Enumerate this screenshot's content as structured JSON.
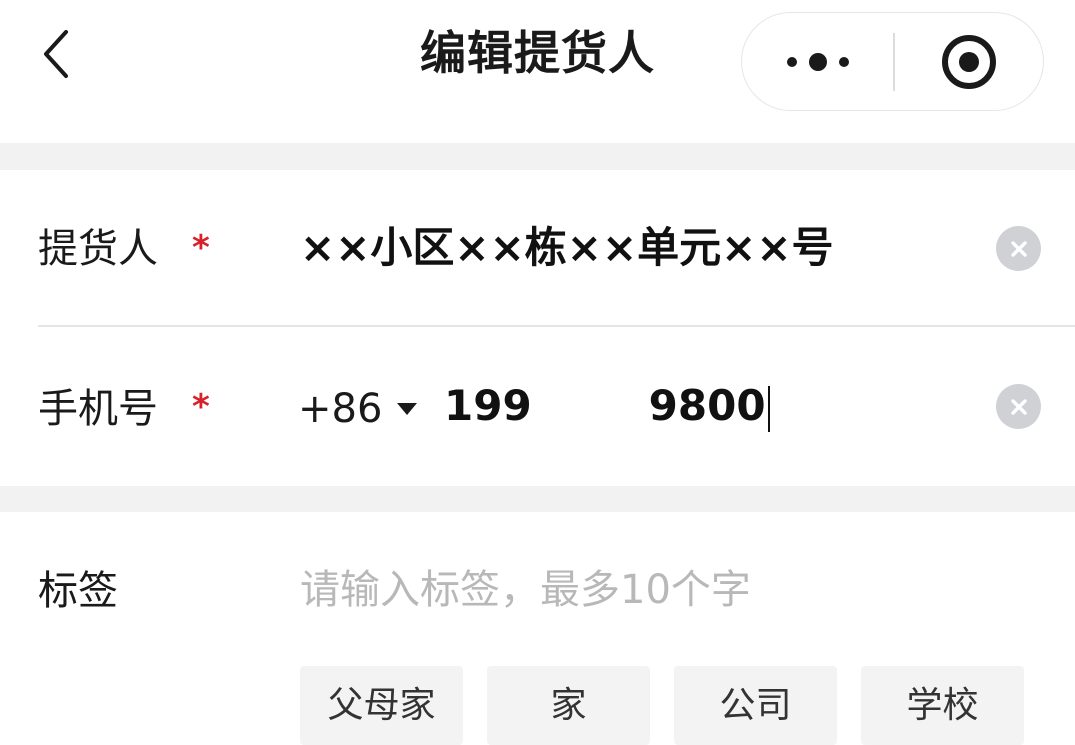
{
  "header": {
    "title": "编辑提货人",
    "back_icon": "chevron-left-icon",
    "more_icon": "more-dots-icon",
    "close_icon": "target-circle-icon"
  },
  "form": {
    "pickup_person": {
      "label": "提货人",
      "required_mark": "*",
      "value": "××小区××栋××单元××号"
    },
    "phone": {
      "label": "手机号",
      "required_mark": "*",
      "country_code": "+86",
      "value": "199        9800"
    },
    "tag": {
      "label": "标签",
      "placeholder": "请输入标签，最多10个字",
      "value": "",
      "options": [
        "父母家",
        "家",
        "公司",
        "学校"
      ]
    }
  },
  "colors": {
    "required": "#d8202a",
    "separator": "#f2f2f2",
    "clear_icon_bg": "#cfd1d4",
    "chip_bg": "#f3f3f3"
  }
}
